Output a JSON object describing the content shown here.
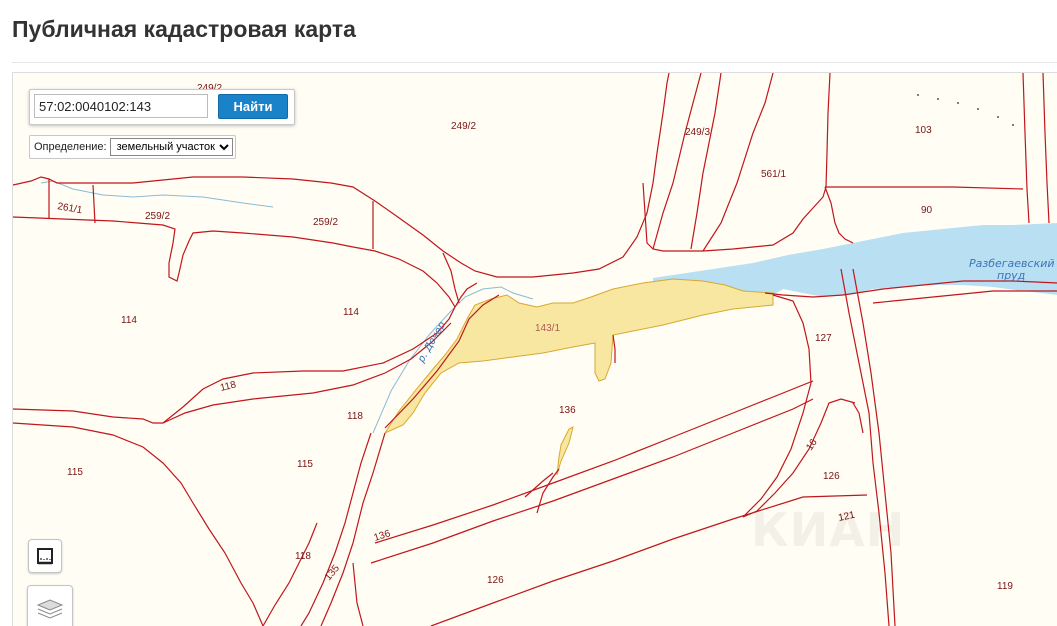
{
  "page": {
    "title": "Публичная кадастровая карта"
  },
  "search": {
    "value": "57:02:0040102:143",
    "button_label": "Найти"
  },
  "definition": {
    "label": "Определение:",
    "selected": "земельный участок"
  },
  "map": {
    "parcel_labels": {
      "p249_2_top": "249/2",
      "p249_2": "249/2",
      "p249_3": "249/3",
      "p103": "103",
      "p561_1": "561/1",
      "p90": "90",
      "p261_1": "261/1",
      "p259_2_a": "259/2",
      "p259_2_b": "259/2",
      "p114_a": "114",
      "p114_b": "114",
      "p143_1": "143/1",
      "p127": "127",
      "p118_a": "118",
      "p118_b": "118",
      "p136_a": "136",
      "p136_b": "136",
      "p115_a": "115",
      "p115_b": "115",
      "p16": "16",
      "p126_a": "126",
      "p126_b": "126",
      "p121": "121",
      "p118_c": "118",
      "p135": "135",
      "p119": "119"
    },
    "water_label_1": "Разбегаевский",
    "water_label_2": "пруд",
    "river_label": "р. Дочер",
    "selected_parcel": "143/1",
    "watermark": "КИАН",
    "colors": {
      "boundary": "#c0161c",
      "selected_fill": "#f8e7a0",
      "water": "#b9dff3",
      "background": "#fffdf4"
    }
  },
  "tools": {
    "ruler_icon": "ruler-icon",
    "layers_icon": "layers-icon"
  }
}
